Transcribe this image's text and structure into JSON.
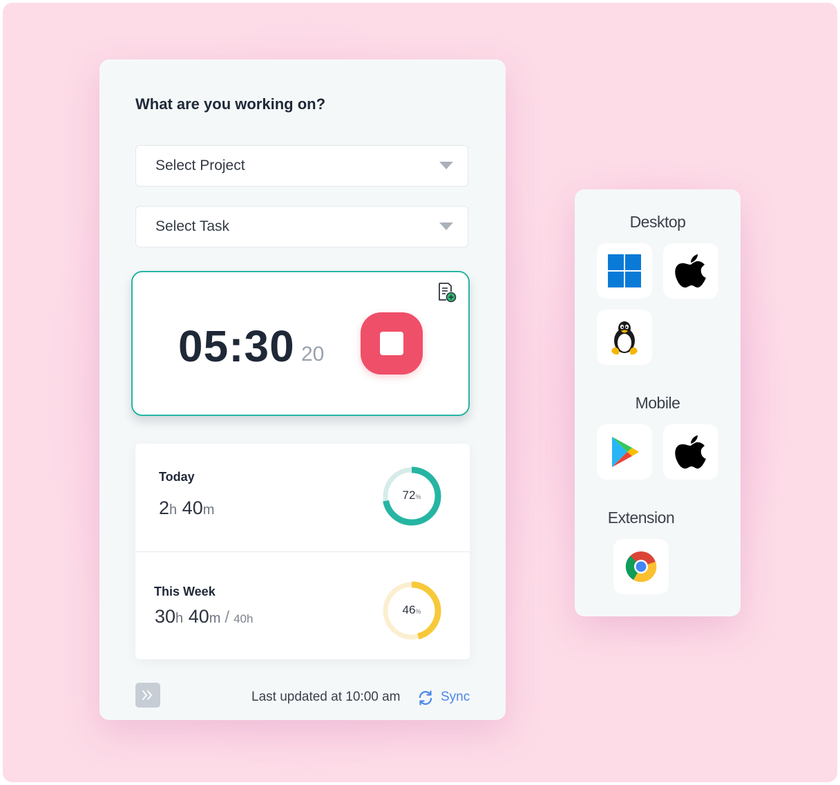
{
  "tracker": {
    "question": "What are you working on?",
    "project_select": {
      "label": "Select Project"
    },
    "task_select": {
      "label": "Select Task"
    },
    "timer": {
      "main": "05:30",
      "seconds": "20"
    },
    "today": {
      "title": "Today",
      "hours": "2",
      "minutes": "40",
      "percent": "72",
      "fraction": 0.72,
      "color": "#26b5a3",
      "track_color": "#d6ece8"
    },
    "week": {
      "title": "This Week",
      "hours": "30",
      "minutes": "40",
      "goal": "40",
      "percent": "46",
      "fraction": 0.46,
      "color": "#f7c93a",
      "track_color": "#fbefd0"
    },
    "units": {
      "h": "h",
      "m": "m",
      "slash": "/",
      "pct": "%"
    },
    "footer": {
      "updated": "Last updated at 10:00 am",
      "sync": "Sync"
    }
  },
  "platforms": {
    "desktop_title": "Desktop",
    "mobile_title": "Mobile",
    "extension_title": "Extension",
    "desktop": [
      {
        "icon": "windows-icon"
      },
      {
        "icon": "apple-icon"
      },
      {
        "icon": "linux-icon"
      }
    ],
    "mobile": [
      {
        "icon": "google-play-icon"
      },
      {
        "icon": "apple-icon"
      }
    ],
    "extension": [
      {
        "icon": "chrome-icon"
      }
    ]
  },
  "colors": {
    "background": "#fddbe7",
    "accent_teal": "#26b5a3",
    "stop_red": "#ef4f69",
    "sync_blue": "#4a86e8"
  }
}
